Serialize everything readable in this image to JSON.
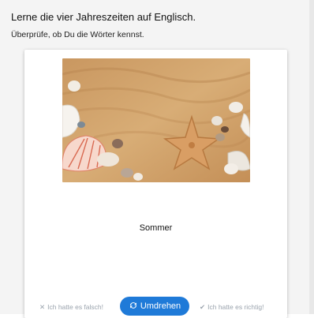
{
  "header": {
    "title": "Lerne die vier Jahreszeiten auf Englisch.",
    "subtitle": "Überprüfe, ob Du die Wörter kennst."
  },
  "card": {
    "image": {
      "icon": "beach-shells-photo"
    },
    "word": "Sommer"
  },
  "buttons": {
    "wrong_label": "Ich hatte es falsch!",
    "flip_label": "Umdrehen",
    "right_label": "Ich hatte es richtig!"
  },
  "colors": {
    "accent": "#1f7ad8",
    "muted": "#9aa3ad",
    "sand": "#d2a56b"
  }
}
